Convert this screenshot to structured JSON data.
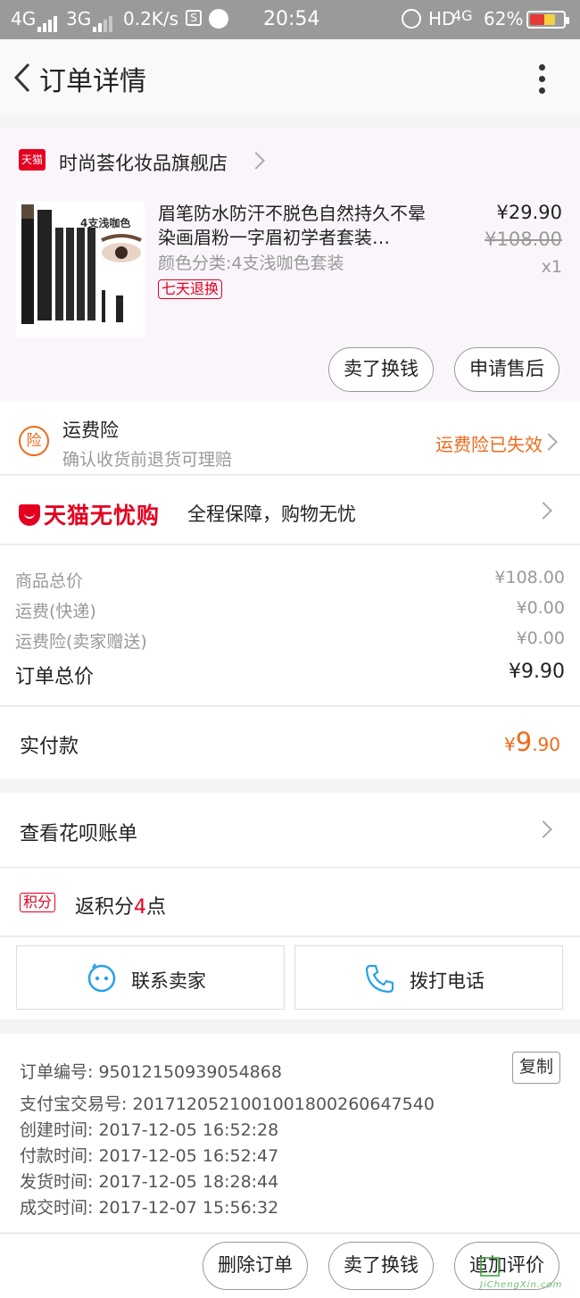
{
  "status_bar": {
    "network1": "4G",
    "network2": "3G",
    "speed": "0.2K/s",
    "time": "20:54",
    "hd": "HD",
    "network3": "4G",
    "battery": "62%",
    "battery_level": 0.62
  },
  "nav": {
    "title": "订单详情"
  },
  "store": {
    "logo_text": "天猫",
    "name": "时尚荟化妆品旗舰店"
  },
  "product": {
    "name": "眉笔防水防汗不脱色自然持久不晕染画眉粉一字眉初学者套装…",
    "spec": "颜色分类:4支浅咖色套装",
    "refund_tag": "七天退换",
    "price": "¥29.90",
    "original_price": "¥108.00",
    "qty": "x1",
    "thumb_text": "4支浅咖色",
    "btn_sell": "卖了换钱",
    "btn_aftersale": "申请售后"
  },
  "insurance": {
    "badge": "险",
    "title": "运费险",
    "subtitle": "确认收货前退货可理赔",
    "status": "运费险已失效"
  },
  "wuyou": {
    "brand": "天猫无忧购",
    "slogan": "全程保障，购物无忧"
  },
  "costs": {
    "rows": [
      {
        "label": "商品总价",
        "value": "¥108.00"
      },
      {
        "label": "运费(快递)",
        "value": "¥0.00"
      },
      {
        "label": "运费险(卖家赠送)",
        "value": "¥0.00"
      }
    ],
    "total_label": "订单总价",
    "total_value": "¥9.90"
  },
  "paid": {
    "label": "实付款",
    "currency": "¥",
    "int": "9",
    "dec": ".90"
  },
  "huabei": {
    "label": "查看花呗账单"
  },
  "points": {
    "tag": "积分",
    "prefix": "返积分",
    "num": "4",
    "suffix": "点"
  },
  "contact": {
    "seller": "联系卖家",
    "phone": "拨打电话"
  },
  "order_info": {
    "order_no": "订单编号: 95012150939054868",
    "alipay_no": "支付宝交易号: 2017120521001001800260647540",
    "created": "创建时间: 2017-12-05 16:52:28",
    "paid": "付款时间: 2017-12-05 16:52:47",
    "shipped": "发货时间: 2017-12-05 18:28:44",
    "done": "成交时间: 2017-12-07 15:56:32",
    "copy": "复制"
  },
  "bottom": {
    "delete": "删除订单",
    "sell": "卖了换钱",
    "review": "追加评价"
  },
  "watermark": {
    "text": "JiChengXin.com"
  },
  "colors": {
    "accent": "#ef6a1a",
    "tmall_red": "#e4001f",
    "status_bar": "#9a9a9a"
  }
}
